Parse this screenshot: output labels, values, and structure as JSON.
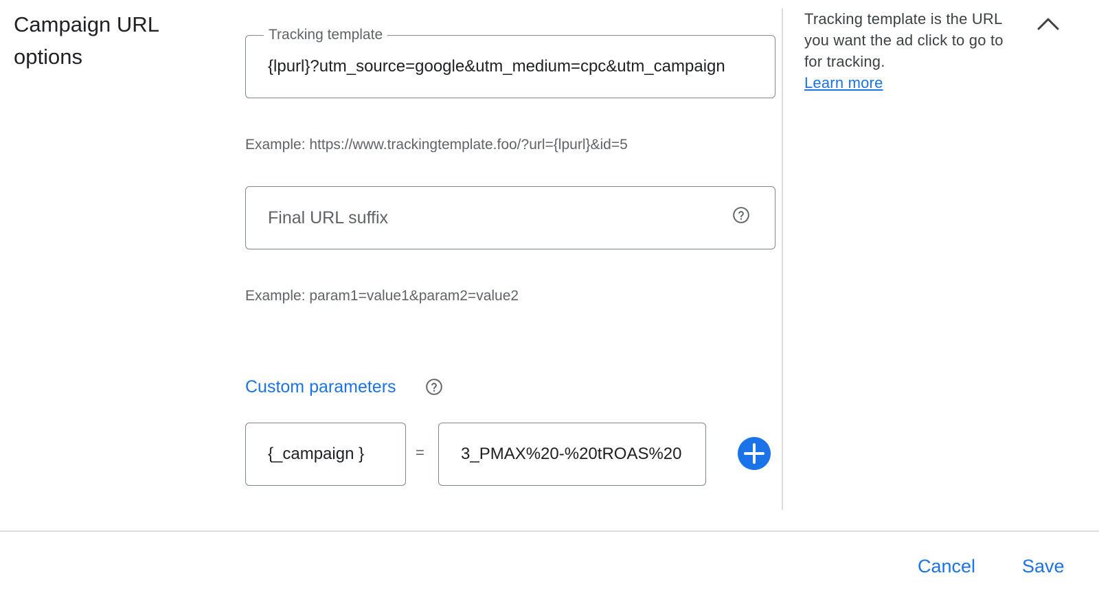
{
  "section": {
    "title": "Campaign URL options"
  },
  "tracking_template": {
    "label": "Tracking template",
    "value": "{lpurl}?utm_source=google&utm_medium=cpc&utm_campaign",
    "example": "Example: https://www.trackingtemplate.foo/?url={lpurl}&id=5"
  },
  "final_url_suffix": {
    "placeholder": "Final URL suffix",
    "example": "Example: param1=value1&param2=value2"
  },
  "custom_parameters": {
    "label": "Custom parameters",
    "name_value": "{_campaign  }",
    "equals": "=",
    "value_value": "3_PMAX%20-%20tROAS%20"
  },
  "help_panel": {
    "text": "Tracking template is the URL you want the ad click to go to for tracking.",
    "link": "Learn more"
  },
  "actions": {
    "cancel_label": "Cancel",
    "save_label": "Save"
  },
  "colors": {
    "accent": "#1a73e8",
    "border": "#80868b",
    "divider": "#dadce0",
    "secondary_text": "#5f6368"
  },
  "icons": {
    "help": "help-circle-icon",
    "add": "plus-circle-icon",
    "collapse": "chevron-up-icon"
  }
}
